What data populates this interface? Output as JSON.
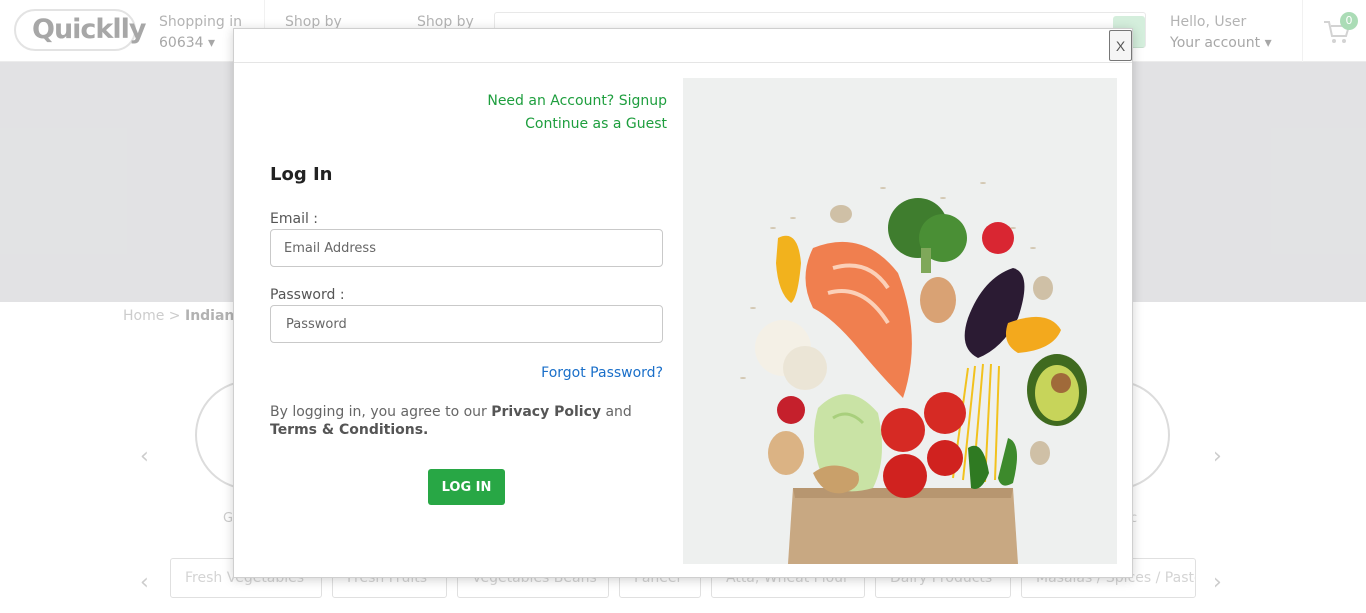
{
  "header": {
    "logo_text": "Quicklly",
    "shopping_in_label": "Shopping in",
    "zip_code": "60634",
    "shop_by_1": "Shop by",
    "shop_by_2": "Shop by",
    "greeting": "Hello, User",
    "account_label": "Your account",
    "cart_count": "0"
  },
  "breadcrumb": {
    "home": "Home",
    "separator": ">",
    "current": "Indian"
  },
  "category_pills": [
    "Fresh Vegetables",
    "Fresh Fruits",
    "Vegetables Beans",
    "Paneer",
    "Atta, Wheat Flour",
    "Dairy Products",
    "Masalas / Spices / Paste"
  ],
  "category_captions": [
    "G",
    "c"
  ],
  "modal": {
    "close_label": "X",
    "signup_link": "Need an Account? Signup",
    "guest_link": "Continue as a Guest",
    "title": "Log In",
    "email_label": "Email :",
    "email_placeholder": "Email Address",
    "password_label": "Password :",
    "password_placeholder": "Password",
    "forgot_link": "Forgot Password?",
    "terms_prefix": "By logging in, you agree to our ",
    "privacy_policy": "Privacy Policy",
    "terms_and": " and",
    "terms_conditions": "Terms & Conditions.",
    "login_button": "LOG IN"
  },
  "colors": {
    "brand_green": "#28a745",
    "link_green": "#1e9e3e",
    "link_blue": "#1a6fc9",
    "banner_gray": "#d8d9db"
  }
}
